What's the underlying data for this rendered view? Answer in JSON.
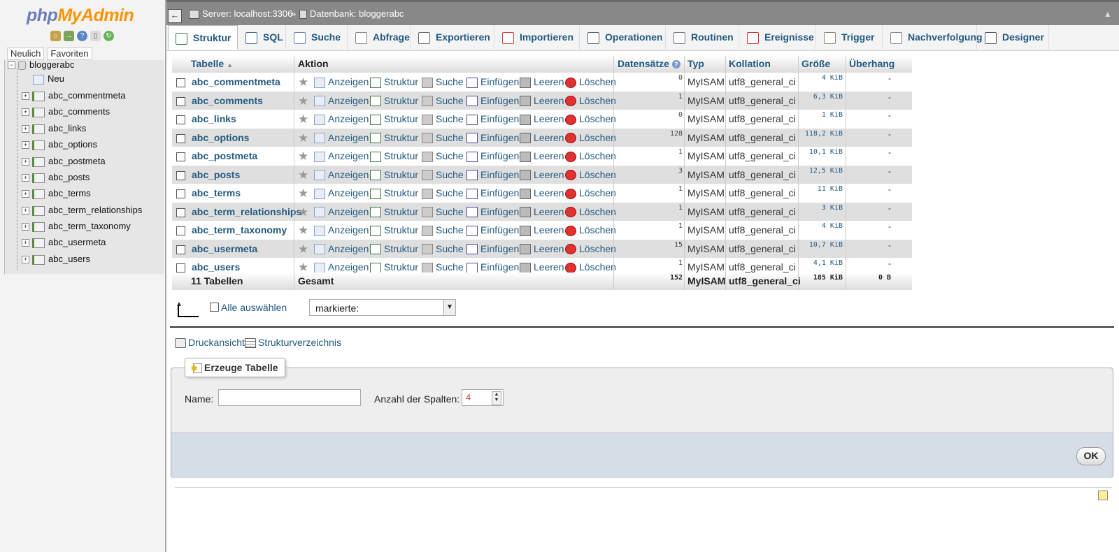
{
  "sidebar": {
    "logo_php": "php",
    "logo_myadmin": "MyAdmin",
    "quick_icons": [
      "home-icon",
      "logout-icon",
      "help-icon",
      "docs-icon",
      "reload-icon"
    ],
    "tab_recent": "Neulich",
    "tab_favorites": "Favoriten",
    "db_name": "bloggerabc",
    "new_label": "Neu",
    "tables": [
      "abc_commentmeta",
      "abc_comments",
      "abc_links",
      "abc_options",
      "abc_postmeta",
      "abc_posts",
      "abc_terms",
      "abc_term_relationships",
      "abc_term_taxonomy",
      "abc_usermeta",
      "abc_users"
    ]
  },
  "topbar": {
    "server": "Server: localhost:3306",
    "separator": "»",
    "database": "Datenbank: bloggerabc"
  },
  "tabs": [
    "Struktur",
    "SQL",
    "Suche",
    "Abfrage",
    "Exportieren",
    "Importieren",
    "Operationen",
    "Routinen",
    "Ereignisse",
    "Trigger",
    "Nachverfolgung",
    "Designer"
  ],
  "table": {
    "headers": {
      "tabelle": "Tabelle",
      "aktion": "Aktion",
      "datensaetze": "Datensätze",
      "typ": "Typ",
      "kollation": "Kollation",
      "groesse": "Größe",
      "ueberhang": "Überhang"
    },
    "actions": {
      "anzeigen": "Anzeigen",
      "struktur": "Struktur",
      "suche": "Suche",
      "einfuegen": "Einfügen",
      "leeren": "Leeren",
      "loeschen": "Löschen"
    },
    "rows": [
      {
        "name": "abc_commentmeta",
        "rows": "0",
        "type": "MyISAM",
        "collation": "utf8_general_ci",
        "size": "4 KiB",
        "overhead": "-"
      },
      {
        "name": "abc_comments",
        "rows": "1",
        "type": "MyISAM",
        "collation": "utf8_general_ci",
        "size": "6,3 KiB",
        "overhead": "-"
      },
      {
        "name": "abc_links",
        "rows": "0",
        "type": "MyISAM",
        "collation": "utf8_general_ci",
        "size": "1 KiB",
        "overhead": "-"
      },
      {
        "name": "abc_options",
        "rows": "128",
        "type": "MyISAM",
        "collation": "utf8_general_ci",
        "size": "118,2 KiB",
        "overhead": "-"
      },
      {
        "name": "abc_postmeta",
        "rows": "1",
        "type": "MyISAM",
        "collation": "utf8_general_ci",
        "size": "10,1 KiB",
        "overhead": "-"
      },
      {
        "name": "abc_posts",
        "rows": "3",
        "type": "MyISAM",
        "collation": "utf8_general_ci",
        "size": "12,5 KiB",
        "overhead": "-"
      },
      {
        "name": "abc_terms",
        "rows": "1",
        "type": "MyISAM",
        "collation": "utf8_general_ci",
        "size": "11 KiB",
        "overhead": "-"
      },
      {
        "name": "abc_term_relationships",
        "rows": "1",
        "type": "MyISAM",
        "collation": "utf8_general_ci",
        "size": "3 KiB",
        "overhead": "-"
      },
      {
        "name": "abc_term_taxonomy",
        "rows": "1",
        "type": "MyISAM",
        "collation": "utf8_general_ci",
        "size": "4 KiB",
        "overhead": "-"
      },
      {
        "name": "abc_usermeta",
        "rows": "15",
        "type": "MyISAM",
        "collation": "utf8_general_ci",
        "size": "10,7 KiB",
        "overhead": "-"
      },
      {
        "name": "abc_users",
        "rows": "1",
        "type": "MyISAM",
        "collation": "utf8_general_ci",
        "size": "4,1 KiB",
        "overhead": "-"
      }
    ],
    "footer": {
      "count": "11 Tabellen",
      "label": "Gesamt",
      "rows": "152",
      "type": "MyISAM",
      "collation": "utf8_general_ci",
      "size": "185 KiB",
      "overhead": "0 B"
    }
  },
  "selection": {
    "select_all": "Alle auswählen",
    "with_selected": "markierte:"
  },
  "links": {
    "print": "Druckansicht",
    "dictionary": "Strukturverzeichnis"
  },
  "create_table": {
    "legend": "Erzeuge Tabelle",
    "name_label": "Name:",
    "name_value": "",
    "columns_label": "Anzahl der Spalten:",
    "columns_value": "4",
    "ok": "OK"
  }
}
